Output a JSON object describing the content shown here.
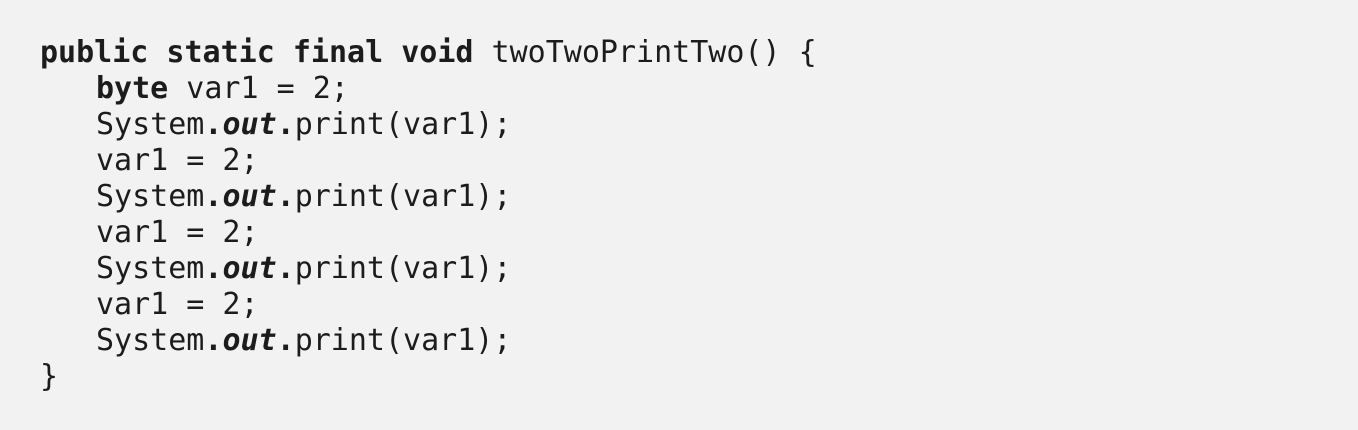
{
  "code": {
    "signature": {
      "keywords": "public static final void",
      "rest": " twoTwoPrintTwo() {"
    },
    "decl": {
      "keyword": "byte",
      "rest": " var1 = 2;"
    },
    "print": {
      "system": "System",
      "dot1": ".",
      "out": "out",
      "dot2": ".",
      "call": "print(var1);"
    },
    "assign": "var1 = 2;",
    "closing": "}"
  }
}
